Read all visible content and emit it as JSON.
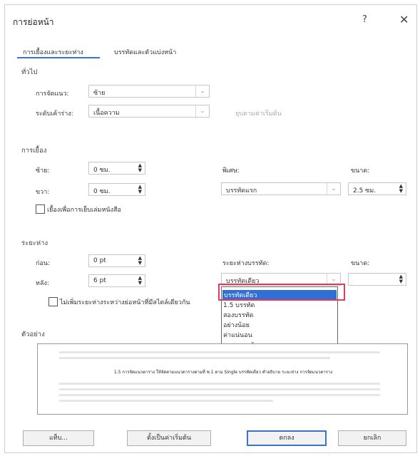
{
  "dialog": {
    "title": "การย่อหน้า",
    "help": "?",
    "close": "✕"
  },
  "tabs": [
    {
      "label": "การเยื้องและระยะห่าง"
    },
    {
      "label": "บรรทัดและตัวแบ่งหน้า"
    }
  ],
  "general": {
    "heading": "ทั่วไป",
    "alignment_label": "การจัดแนว:",
    "alignment_value": "ซ้าย",
    "outline_label": "ระดับเค้าร่าง:",
    "outline_value": "เนื้อความ",
    "collapsed_label": "ยุบตามค่าเริ่มต้น"
  },
  "indentation": {
    "heading": "การเยื้อง",
    "left_label": "ซ้าย:",
    "left_value": "0 ซม.",
    "right_label": "ขวา:",
    "right_value": "0 ซม.",
    "special_label": "พิเศษ:",
    "special_value": "บรรทัดแรก",
    "by_label": "ขนาด:",
    "by_value": "2.5 ซม.",
    "mirror_label": "เยื้องเพื่อการเย็บเล่มหนังสือ"
  },
  "spacing": {
    "heading": "ระยะห่าง",
    "before_label": "ก่อน:",
    "before_value": "0 pt",
    "after_label": "หลัง:",
    "after_value": "6 pt",
    "line_spacing_label": "ระยะห่างบรรทัด:",
    "line_spacing_value": "บรรทัดเดียว",
    "at_label": "ขนาด:",
    "dont_add_label": "ไม่เพิ่มระยะห่างระหว่างย่อหน้าที่มีสไตล์เดียวกัน",
    "options": [
      "บรรทัดเดียว",
      "1.5 บรรทัด",
      "สองบรรทัด",
      "อย่างน้อย",
      "ค่าแน่นอน",
      "หลายบรรทัด"
    ],
    "selected_index": 0
  },
  "preview": {
    "heading": "ตัวอย่าง",
    "sample_text": "1.5 การจัดแนวตาราง ให้จัดตามแนวตารางตามที่ ซ.1 ตาม Single บรรทัดเดียว คำอธิบาย ระยะห่าง การจัดแนวตาราง"
  },
  "buttons": {
    "tabs": "แท็บ...",
    "set_default": "ตั้งเป็นค่าเริ่มต้น",
    "ok": "ตกลง",
    "cancel": "ยกเลิก"
  },
  "colors": {
    "accent": "#3a73c8",
    "selection": "#2f6fd6",
    "highlight": "#e03c5a"
  }
}
